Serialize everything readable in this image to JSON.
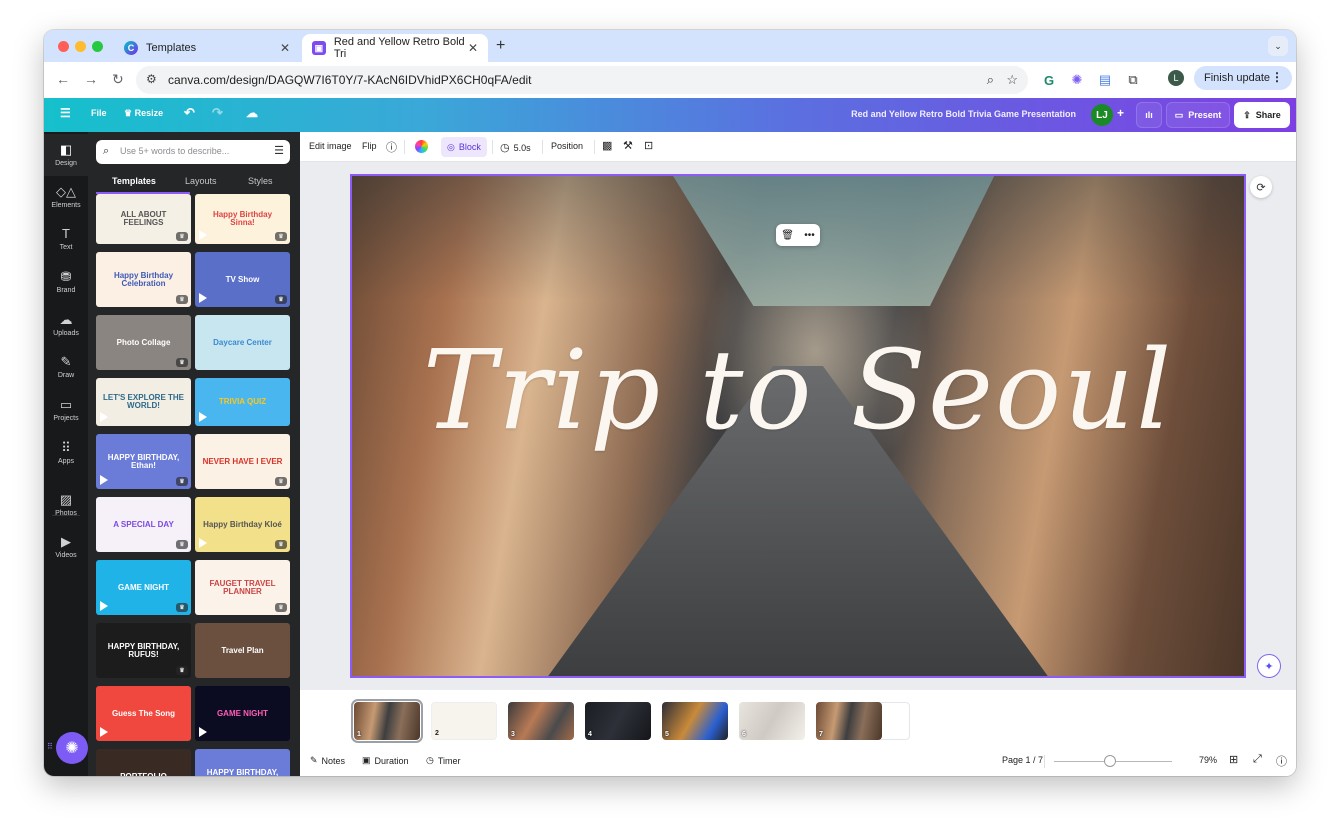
{
  "browser": {
    "tabs": [
      {
        "title": "Templates",
        "icon": "canva-logo-icon",
        "active": false
      },
      {
        "title": "Red and Yellow Retro Bold Tri",
        "icon": "canva-presentation-icon",
        "active": true
      }
    ],
    "new_tab": "+",
    "url": "canva.com/design/DAGQW7I6T0Y/7-KAcN6IDVhidPX6CH0qFA/edit",
    "profile_initial": "L",
    "finish_update_label": "Finish update"
  },
  "header": {
    "menu_icon": "☰",
    "file_label": "File",
    "resize_label": "Resize",
    "document_title": "Red and Yellow Retro Bold Trivia Game Presentation",
    "collaborator_initials": "LJ",
    "present_label": "Present",
    "share_label": "Share"
  },
  "rail": {
    "items": [
      {
        "label": "Design",
        "icon": "design-icon",
        "active": true
      },
      {
        "label": "Elements",
        "icon": "elements-icon"
      },
      {
        "label": "Text",
        "icon": "text-icon"
      },
      {
        "label": "Brand",
        "icon": "brand-icon"
      },
      {
        "label": "Uploads",
        "icon": "uploads-icon"
      },
      {
        "label": "Draw",
        "icon": "draw-icon"
      },
      {
        "label": "Projects",
        "icon": "projects-icon"
      },
      {
        "label": "Apps",
        "icon": "apps-icon"
      },
      {
        "label": "Photos",
        "icon": "photos-icon"
      },
      {
        "label": "Videos",
        "icon": "videos-icon"
      }
    ]
  },
  "panel": {
    "search_placeholder": "Use 5+ words to describe...",
    "tabs": [
      "Templates",
      "Layouts",
      "Styles"
    ],
    "active_tab": "Templates",
    "templates": [
      {
        "title": "ALL ABOUT FEELINGS",
        "premium": true
      },
      {
        "title": "Happy Birthday Sinna!",
        "premium": true,
        "video": true
      },
      {
        "title": "Happy Birthday Celebration",
        "premium": true
      },
      {
        "title": "TV Show",
        "premium": true,
        "video": true
      },
      {
        "title": "Photo Collage",
        "premium": true
      },
      {
        "title": "Daycare Center",
        "premium": false
      },
      {
        "title": "LET'S EXPLORE THE WORLD!",
        "premium": false,
        "video": true
      },
      {
        "title": "TRIVIA QUIZ",
        "premium": false,
        "video": true
      },
      {
        "title": "HAPPY BIRTHDAY, Ethan!",
        "premium": true,
        "video": true
      },
      {
        "title": "NEVER HAVE I EVER",
        "premium": true
      },
      {
        "title": "A SPECIAL DAY",
        "premium": true
      },
      {
        "title": "Happy Birthday Kloé",
        "premium": true,
        "video": true
      },
      {
        "title": "GAME NIGHT",
        "premium": true,
        "video": true
      },
      {
        "title": "FAUGET TRAVEL PLANNER",
        "premium": true
      },
      {
        "title": "HAPPY BIRTHDAY, RUFUS!",
        "premium": true
      },
      {
        "title": "Travel Plan",
        "premium": false
      },
      {
        "title": "Guess The Song",
        "premium": false,
        "video": true
      },
      {
        "title": "GAME NIGHT",
        "premium": false,
        "video": true
      },
      {
        "title": "PORTFOLIO",
        "premium": true
      },
      {
        "title": "HAPPY BIRTHDAY, Ethan!",
        "premium": true,
        "video": true
      }
    ]
  },
  "toolbar": {
    "edit_image": "Edit image",
    "flip": "Flip",
    "block": "Block",
    "duration": "5.0s",
    "position": "Position"
  },
  "slide": {
    "title": "Trip to Seoul"
  },
  "pages": {
    "items": [
      {
        "num": "1",
        "active": true
      },
      {
        "num": "2"
      },
      {
        "num": "3"
      },
      {
        "num": "4"
      },
      {
        "num": "5"
      },
      {
        "num": "6"
      },
      {
        "num": "7"
      }
    ],
    "add_label": "+"
  },
  "footer": {
    "notes": "Notes",
    "duration": "Duration",
    "timer": "Timer",
    "page_indicator": "Page 1 / 7",
    "zoom": "79%",
    "zoom_value_percent": 79
  },
  "colors": {
    "accent": "#8b5cf6",
    "header_gradient_start": "#15c0cc",
    "header_gradient_end": "#7d3fe3",
    "panel_bg": "#252627"
  }
}
